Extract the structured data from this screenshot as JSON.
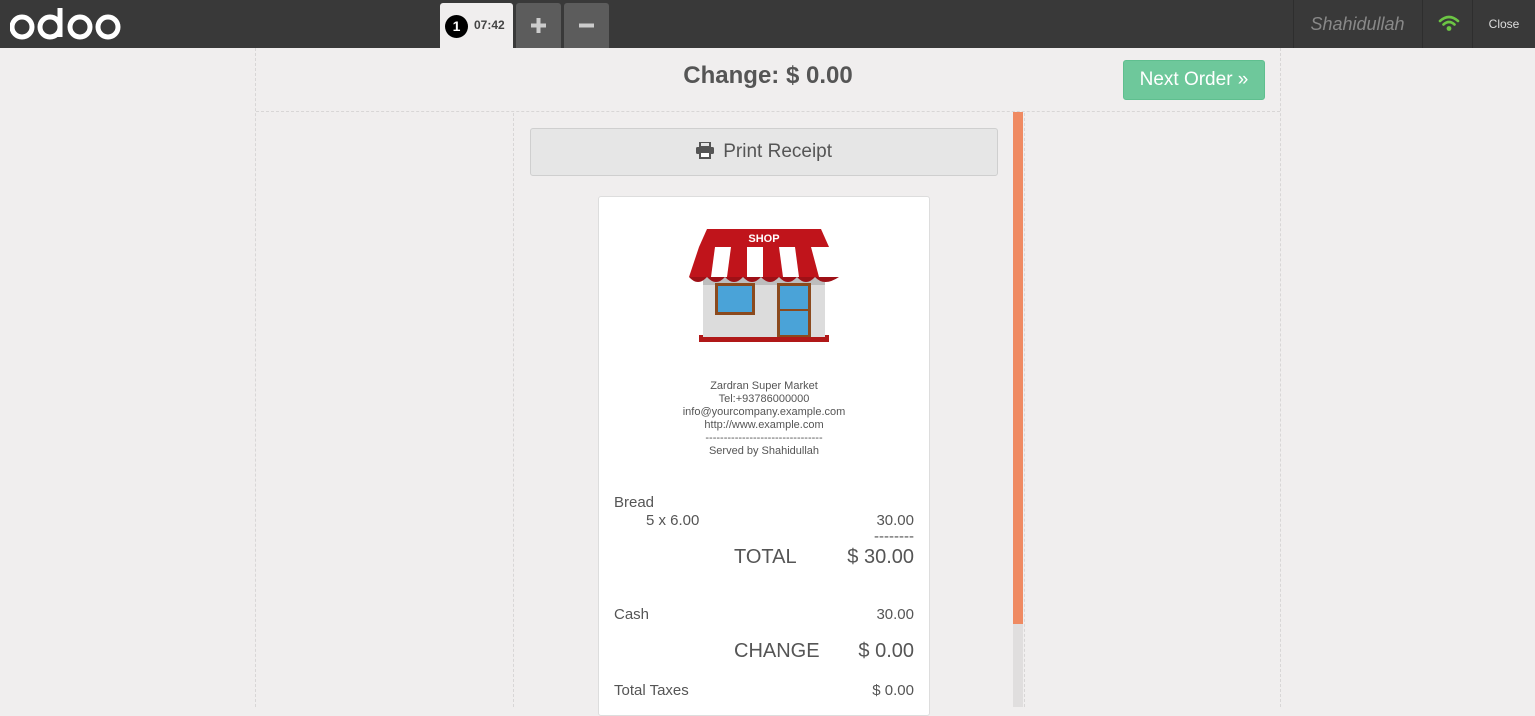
{
  "topbar": {
    "logo_text": "odoo",
    "order": {
      "number": "1",
      "time": "07:42"
    },
    "add_icon": "plus-icon",
    "remove_icon": "minus-icon",
    "user": "Shahidullah",
    "wifi_icon": "wifi-icon",
    "close_label": "Close"
  },
  "screen": {
    "change_title": "Change: $ 0.00",
    "next_order_label": "Next Order »",
    "print_label": "Print Receipt"
  },
  "receipt": {
    "logo_label": "SHOP",
    "company": {
      "name": "Zardran Super Market",
      "tel": "Tel:+93786000000",
      "email": "info@yourcompany.example.com",
      "website": "http://www.example.com",
      "separator": "--------------------------------",
      "served_by": "Served by Shahidullah"
    },
    "items": [
      {
        "name": "Bread",
        "qty_price": "5 x 6.00",
        "amount": "30.00"
      }
    ],
    "dash": "--------",
    "total_label": "TOTAL",
    "total_value": "$ 30.00",
    "payment_label": "Cash",
    "payment_value": "30.00",
    "change_label": "CHANGE",
    "change_value": "$ 0.00",
    "taxes_label": "Total Taxes",
    "taxes_value": "$ 0.00"
  },
  "colors": {
    "topbar": "#393939",
    "next_order": "#6ec89b",
    "scrollbar": "#ef8a62",
    "wifi": "#6cc644"
  }
}
